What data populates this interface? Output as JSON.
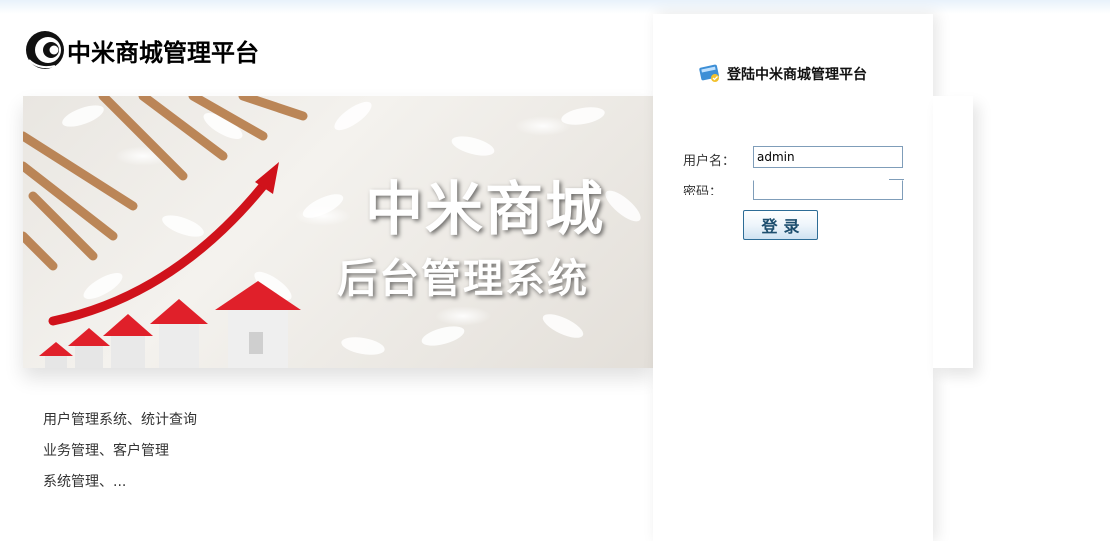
{
  "header": {
    "site_title": "中米商城管理平台",
    "logo_icon": "zhongmi-logo-icon"
  },
  "banner": {
    "title": "中米商城",
    "subtitle": "后台管理系统",
    "graphic": "rising-arrow-houses-rice-illustration"
  },
  "features": [
    "用户管理系统、统计查询",
    "业务管理、客户管理",
    "系统管理、..."
  ],
  "login": {
    "title": "登陆中米商城管理平台",
    "icon": "login-card-icon",
    "username_label": "用户名：",
    "username_value": "admin",
    "password_label": "密码：",
    "password_value": "",
    "submit_label": "登录"
  },
  "colors": {
    "button_border": "#2d6c96",
    "button_text": "#1d4e6e",
    "input_border": "#7f9db9",
    "arrow_red": "#d0121b",
    "roof_red": "#e0202a"
  }
}
